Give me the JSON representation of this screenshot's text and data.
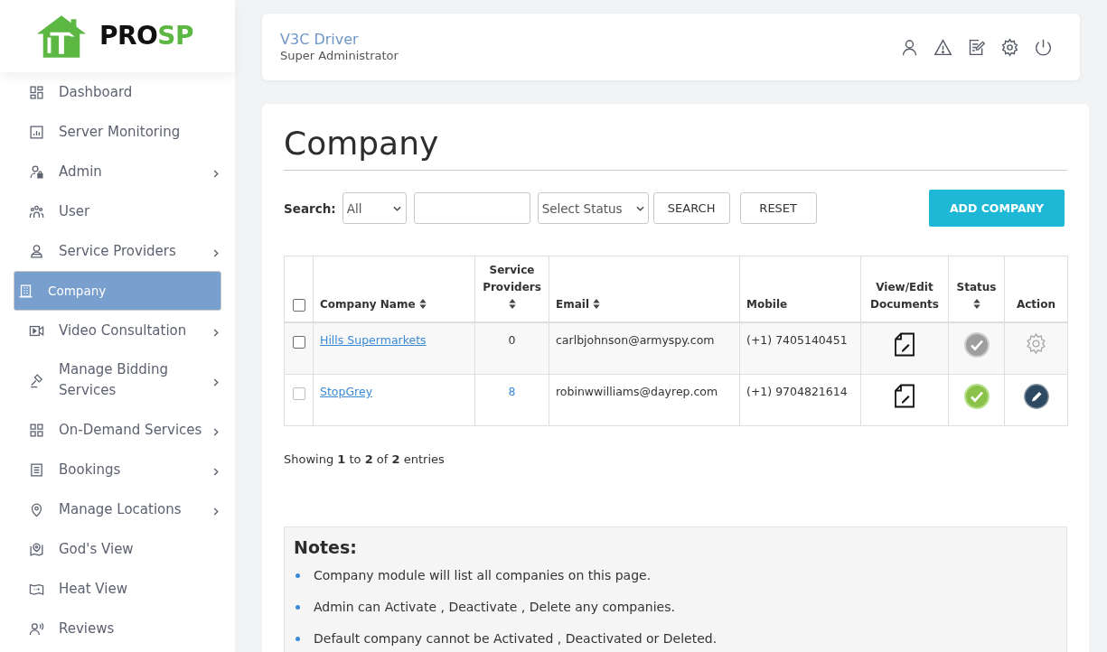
{
  "brand": {
    "text": "PRO",
    "accent_text": "SP"
  },
  "sidebar": {
    "items": [
      {
        "label": "Dashboard",
        "expandable": false,
        "selected": false
      },
      {
        "label": "Server Monitoring",
        "expandable": false,
        "selected": false
      },
      {
        "label": "Admin",
        "expandable": true,
        "selected": false
      },
      {
        "label": "User",
        "expandable": false,
        "selected": false
      },
      {
        "label": "Service Providers",
        "expandable": true,
        "selected": false
      },
      {
        "label": "Company",
        "expandable": false,
        "selected": true
      },
      {
        "label": "Video Consultation",
        "expandable": true,
        "selected": false
      },
      {
        "label": "Manage Bidding Services",
        "expandable": true,
        "selected": false
      },
      {
        "label": "On-Demand Services",
        "expandable": true,
        "selected": false
      },
      {
        "label": "Bookings",
        "expandable": true,
        "selected": false
      },
      {
        "label": "Manage Locations",
        "expandable": true,
        "selected": false
      },
      {
        "label": "God's View",
        "expandable": false,
        "selected": false
      },
      {
        "label": "Heat View",
        "expandable": false,
        "selected": false
      },
      {
        "label": "Reviews",
        "expandable": false,
        "selected": false
      }
    ]
  },
  "header": {
    "user_name": "V3C Driver",
    "role": "Super Administrator"
  },
  "page": {
    "title": "Company",
    "search": {
      "label": "Search:",
      "field_select": "All",
      "status_select": "Select Status",
      "buttons": [
        "SEARCH",
        "RESET"
      ]
    },
    "add_button": "ADD COMPANY",
    "table": {
      "select_all_checked": false,
      "columns": [
        {
          "label": "Company Name",
          "sortable": true
        },
        {
          "label": "Service Providers",
          "sortable": true
        },
        {
          "label": "Email",
          "sortable": true
        },
        {
          "label": "Mobile",
          "sortable": false
        },
        {
          "label": "View/Edit Documents",
          "sortable": false
        },
        {
          "label": "Status",
          "sortable": true
        },
        {
          "label": "Action",
          "sortable": false
        }
      ],
      "rows": [
        {
          "checked": false,
          "disabled": false,
          "company_name": "Hills Supermarkets",
          "service_providers": "0",
          "providers_linked": false,
          "email": "carlbjohnson@armyspy.com",
          "mobile": "(+1) 7405140451",
          "active": false,
          "action": {
            "kind": "settings"
          }
        },
        {
          "checked": false,
          "disabled": true,
          "company_name": "StopGrey",
          "service_providers": "8",
          "providers_linked": true,
          "email": "robinwwilliams@dayrep.com",
          "mobile": "(+1) 9704821614",
          "active": true,
          "action": {
            "kind": "edit"
          }
        }
      ]
    },
    "summary": "Showing **1** to **2** of **2** entries",
    "notes": {
      "title": "Notes:",
      "items": [
        "Company module will list all companies on this page.",
        "Admin can Activate , Deactivate , Delete any companies.",
        "Default company cannot be Activated , Deactivated or Deleted."
      ]
    }
  }
}
